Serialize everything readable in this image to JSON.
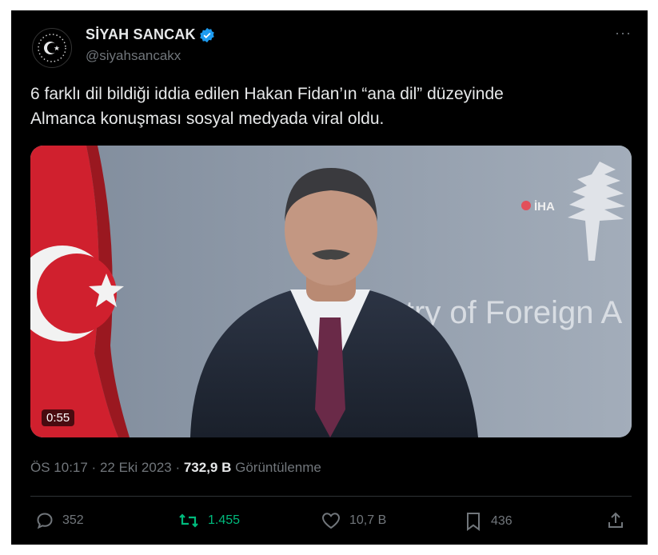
{
  "author": {
    "display_name": "SİYAH SANCAK",
    "handle": "@siyahsancakx",
    "verified_icon": "verified-badge-icon",
    "avatar_icon": "star-crescent-icon"
  },
  "more_label": "···",
  "tweet": {
    "text_line1": "6 farklı dil bildiği iddia edilen Hakan Fidan’ın “ana dil” düzeyinde",
    "text_line2": "Almanca konuşması sosyal medyada viral oldu."
  },
  "media": {
    "duration": "0:55",
    "watermark": "İHA",
    "backdrop_text": "istry of Foreign A"
  },
  "meta": {
    "time": "ÖS 10:17",
    "sep1": " · ",
    "date": "22 Eki 2023",
    "sep2": " · ",
    "views_count": "732,9 B",
    "views_label": " Görüntülenme"
  },
  "actions": {
    "replies": "352",
    "retweets": "1.455",
    "likes": "10,7 B",
    "bookmarks": "436"
  },
  "colors": {
    "background": "#000000",
    "text": "#e7e9ea",
    "muted": "#71767b",
    "verified": "#1d9bf0",
    "retweet_active": "#00ba7c"
  }
}
